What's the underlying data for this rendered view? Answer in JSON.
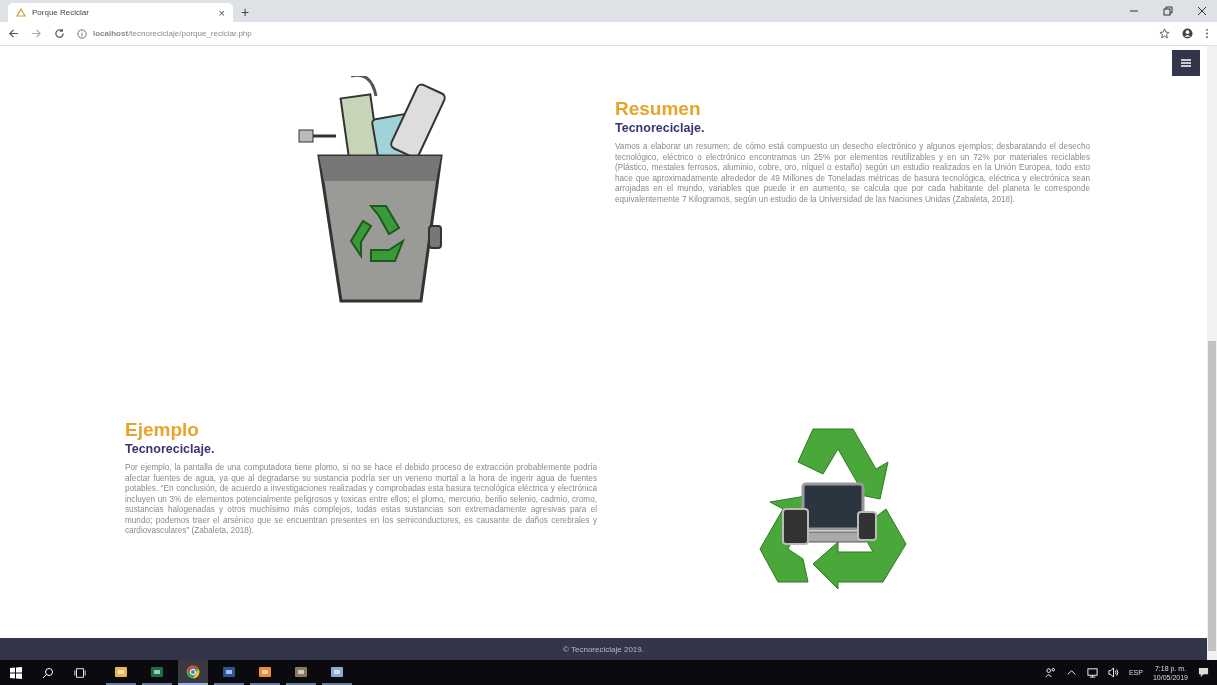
{
  "browser": {
    "tab": {
      "title": "Porque Reciclar",
      "close": "×"
    },
    "new_tab": "+",
    "url": "**localhost**/tecnoreciclaje/porque_reciclar.php"
  },
  "sections": [
    {
      "kind": "bin_left",
      "title": "Resumen",
      "subtitle": "Tecnoreciclaje.",
      "body": "Vamos a elaborar un resumen; de cómo está compuesto un desecho electrónico y algunos ejemplos; desbaratando el desecho tecnológico, eléctrico o electrónico encontramos un 25% por elementos reutilizables y en un 72% por materiales reciclables (Plástico, mestales ferrosos, aluminio, cobre, oro, níquel o estaño) según un estudio realizados en la Unión Europea, todo esto hace que aproximadamente alrededor de 49 Millones de Toneladas métricas de basura tecnológica, eléctrica y electrónica sean arrojadas en el mundo, variables que puede ir en aumento, se calcula que por cada habitante del planeta le corresponde equivalentemente 7 Kilogramos, según un estudio de la Universidad de las Naciones Unidas (Zabaleta, 2018)."
    },
    {
      "kind": "recycle_right",
      "title": "Ejemplo",
      "subtitle": "Tecnoreciclaje.",
      "body": "Por ejemplo, la pantalla de una computadora tiene plomo, si no se hace el debido proceso de extracción probablemente podría afectar fuentes de agua, ya que al degradarse su sustancia podría ser un veneno mortal a la hora de ingerir agua de fuentes potables. “En conclusión, de acuerdo a investigaciones realizadas y comprobadas esta basura tecnológica eléctrica y electrónica incluyen un 3% de elementos potencialmente peligrosos y toxicas entre ellos; el plomo, mercurio, berilio selenio, cadmio, cromo, sustancias halogenadas y otros muchísimo más complejos, todas estas sustancias son extremadamente agresivas para el mundo; podemos traer el arsénico que se encuentran presentes en los semiconductores, es causante de daños cerebrales y cardiovasculares” (Zabaleta, 2018)."
    }
  ],
  "footer": "© Tecnoreciclaje 2019.",
  "taskbar": {
    "apps": [
      {
        "kind": "explorer",
        "selected": false
      },
      {
        "kind": "excel",
        "selected": false
      },
      {
        "kind": "chrome",
        "selected": true
      },
      {
        "kind": "word",
        "selected": false
      },
      {
        "kind": "xampp",
        "selected": false
      },
      {
        "kind": "tool",
        "selected": false
      },
      {
        "kind": "paint",
        "selected": false
      }
    ],
    "language": "ESP",
    "time": "7:18 p. m.",
    "date": "10/05/2019"
  }
}
